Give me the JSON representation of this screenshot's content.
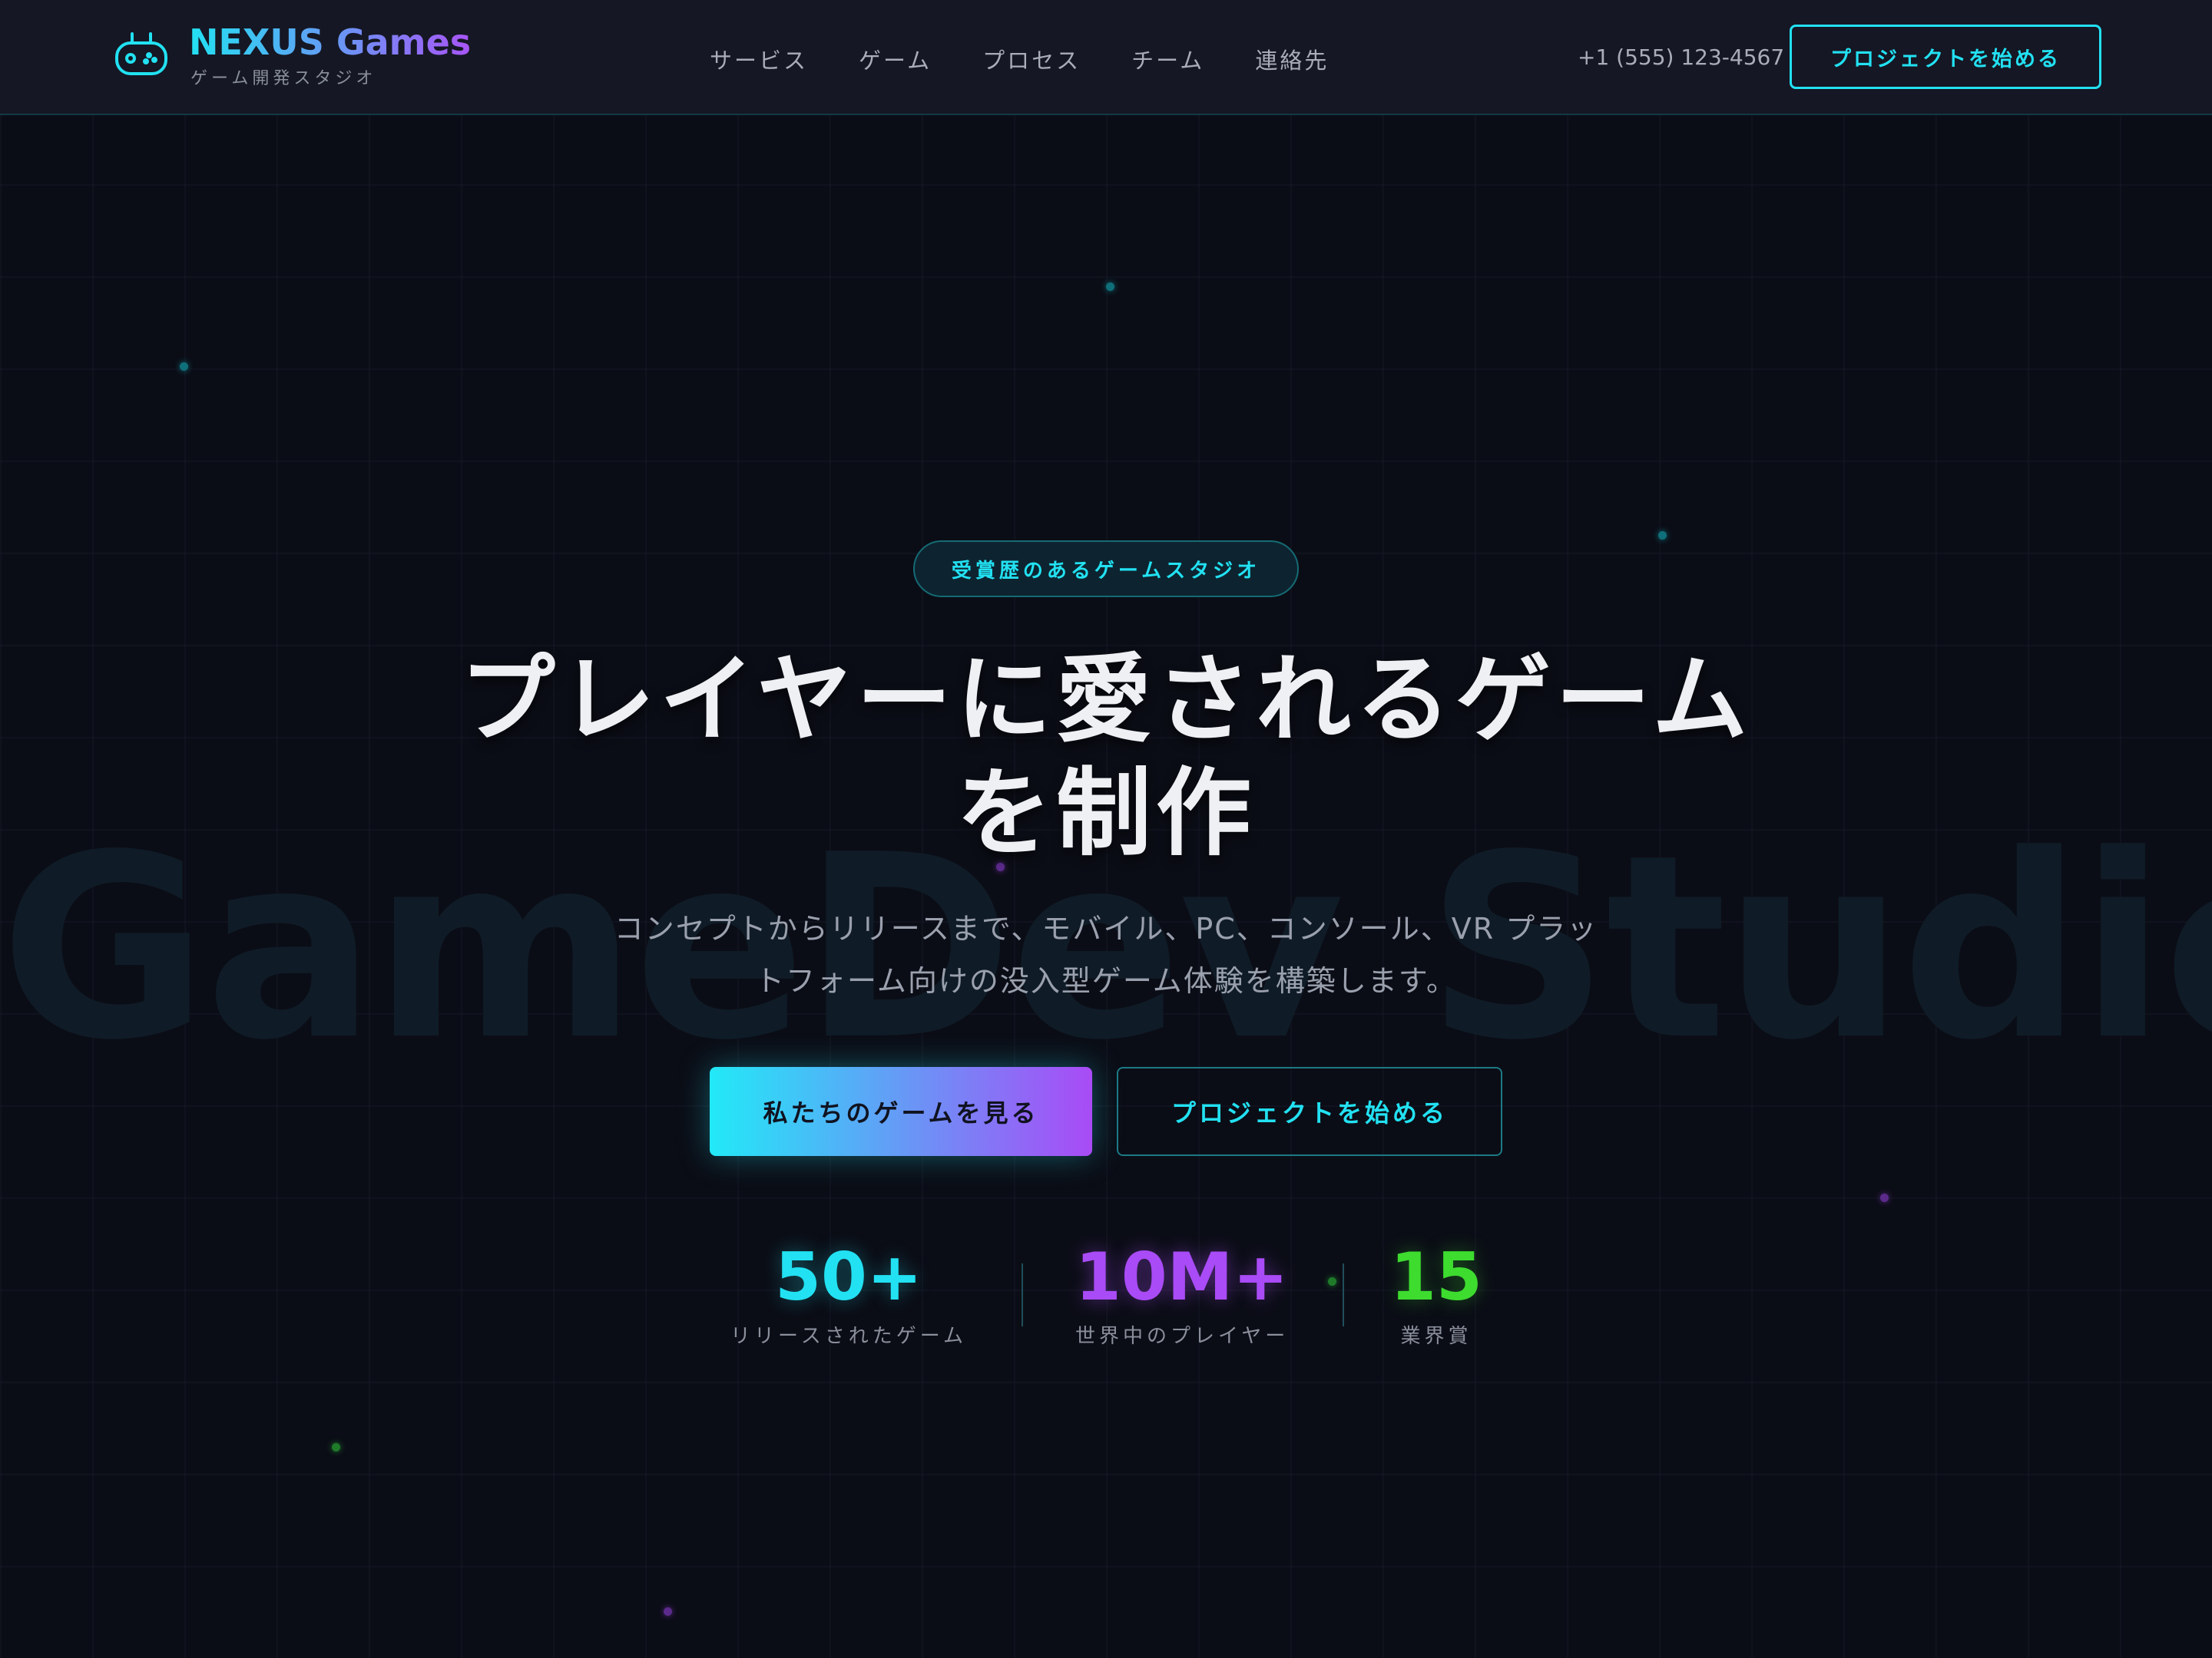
{
  "brand": {
    "name": "NEXUS Games",
    "tagline": "ゲーム開発スタジオ"
  },
  "nav": {
    "items": [
      {
        "label": "サービス"
      },
      {
        "label": "ゲーム"
      },
      {
        "label": "プロセス"
      },
      {
        "label": "チーム"
      },
      {
        "label": "連絡先"
      }
    ]
  },
  "header": {
    "phone": "+1 (555) 123-4567",
    "cta_label": "プロジェクトを始める"
  },
  "hero": {
    "badge": "受賞歴のあるゲームスタジオ",
    "title_line1": "プレイヤーに愛されるゲーム",
    "title_line2": "を制作",
    "subtitle_line1": "コンセプトからリリースまで、モバイル、PC、コンソール、VR プラッ",
    "subtitle_line2": "トフォーム向けの没入型ゲーム体験を構築します。",
    "watermark": "GameDev Studio",
    "primary_button": "私たちのゲームを見る",
    "secondary_button": "プロジェクトを始める"
  },
  "stats": [
    {
      "value": "50+",
      "label": "リリースされたゲーム"
    },
    {
      "value": "10M+",
      "label": "世界中のプレイヤー"
    },
    {
      "value": "15",
      "label": "業界賞"
    }
  ],
  "colors": {
    "background": "#0b0d16",
    "header_background": "#151724",
    "accent_cyan": "#22e1f2",
    "accent_purple": "#a94bf6",
    "accent_green": "#3ddc2f"
  },
  "icons": {
    "logo": "gamepad-icon"
  }
}
